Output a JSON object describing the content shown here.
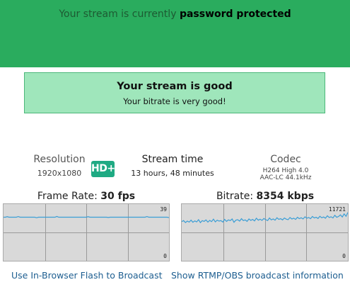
{
  "banner": {
    "prefix": "Your stream is currently",
    "emphasis": "password protected",
    "color": "#2aac5e"
  },
  "status": {
    "title": "Your stream is good",
    "subtitle": "Your bitrate is very good!",
    "color": "#9fe6bb"
  },
  "stats": {
    "resolution": {
      "label": "Resolution",
      "value": "1920x1080"
    },
    "hd_badge": "HD+",
    "stream_time": {
      "label": "Stream time",
      "value": "13 hours, 48 minutes"
    },
    "codec": {
      "label": "Codec",
      "video": "H264 High 4.0",
      "audio": "AAC-LC 44.1kHz"
    }
  },
  "graphs": {
    "framerate": {
      "label": "Frame Rate:",
      "value": "30 fps",
      "max_label": "39",
      "min_label": "0",
      "ymax": 39,
      "values": [
        30,
        30,
        30.3,
        30,
        30,
        30,
        30,
        30,
        30.4,
        30,
        30,
        30,
        30,
        30,
        30,
        30,
        30,
        30,
        29.6,
        30,
        30,
        30,
        30,
        30,
        30,
        30,
        30,
        30,
        30,
        30.5,
        30,
        30,
        30,
        30,
        30,
        30,
        30,
        30,
        30,
        30,
        30,
        30,
        30,
        30,
        30,
        30,
        30.3,
        30,
        30,
        30,
        30,
        30,
        30,
        30,
        30,
        30,
        30,
        29.8,
        30,
        30,
        30,
        30,
        30,
        30,
        30,
        30,
        30,
        30,
        30,
        30,
        30,
        30,
        30,
        30,
        30,
        30,
        30,
        30,
        30.4,
        30,
        30,
        30,
        30,
        30,
        30,
        30,
        30,
        30,
        30,
        30,
        29.7
      ]
    },
    "bitrate": {
      "label": "Bitrate:",
      "value": "8354 kbps",
      "max_label": "11721",
      "min_label": "0",
      "ymax": 11721,
      "values": [
        8100,
        8300,
        7900,
        8200,
        8000,
        8400,
        7950,
        8250,
        8050,
        8500,
        7900,
        8300,
        8150,
        8450,
        8000,
        8350,
        8100,
        8600,
        8050,
        8400,
        8200,
        8300,
        8000,
        8550,
        8150,
        8450,
        8300,
        8650,
        7950,
        8400,
        8500,
        8200,
        8700,
        8300,
        8450,
        8150,
        8650,
        8350,
        8550,
        8250,
        8800,
        8400,
        8600,
        8350,
        8750,
        8500,
        8300,
        8850,
        8450,
        8650,
        8400,
        8900,
        8550,
        8700,
        8450,
        8850,
        8600,
        8500,
        8950,
        8650,
        8800,
        8550,
        9000,
        8700,
        8900,
        8650,
        9100,
        8800,
        8950,
        8700,
        9150,
        8850,
        9000,
        8750,
        9200,
        8900,
        9050,
        8800,
        9300,
        8950,
        9100,
        8850,
        9400,
        9000,
        9150,
        9500,
        9050,
        9700,
        9200,
        10000
      ]
    }
  },
  "links": {
    "flash": "Use In-Browser Flash to Broadcast",
    "rtmp": "Show RTMP/OBS broadcast information"
  }
}
